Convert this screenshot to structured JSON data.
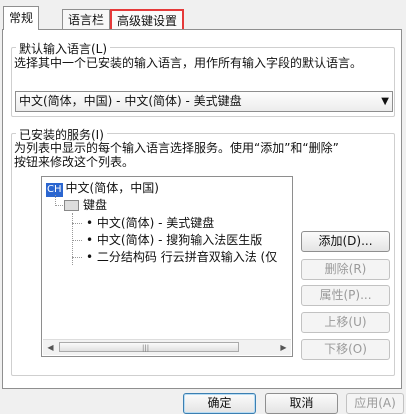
{
  "tabs": [
    {
      "label": "常规"
    },
    {
      "label": "语言栏"
    },
    {
      "label": "高级键设置"
    }
  ],
  "default_lang": {
    "legend": "默认输入语言(L)",
    "description": "选择其中一个已安装的输入语言，用作所有输入字段的默认语言。",
    "selected": "中文(简体，中国) - 中文(简体) - 美式键盘"
  },
  "services": {
    "legend": "已安装的服务(I)",
    "description_line1": "为列表中显示的每个输入语言选择服务。使用“添加”和“删除”",
    "description_line2": "按钮来修改这个列表。",
    "tree": {
      "lang_code": "CH",
      "lang_label": "中文(简体，中国)",
      "group_label": "键盘",
      "items": [
        "中文(简体) - 美式键盘",
        "中文(简体) - 搜狗输入法医生版",
        "二分结构码 行云拼音双输入法 (仅"
      ]
    },
    "scroll_left": "◀",
    "scroll_right": "▶",
    "grip": "|||"
  },
  "side_buttons": {
    "add": "添加(D)...",
    "remove": "删除(R)",
    "properties": "属性(P)...",
    "move_up": "上移(U)",
    "move_down": "下移(O)"
  },
  "footer": {
    "ok": "确定",
    "cancel": "取消",
    "apply": "应用(A)"
  },
  "icons": {
    "dropdown": "▼"
  },
  "colors": {
    "tab_highlight": "#e53a3a",
    "lang_badge": "#2b66d0"
  }
}
